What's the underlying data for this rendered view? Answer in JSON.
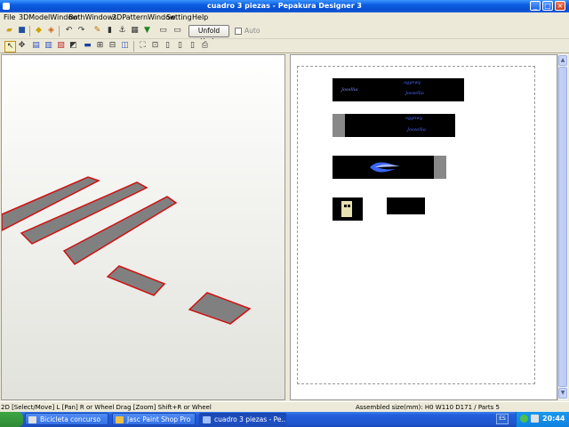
{
  "window": {
    "title": "cuadro 3 piezas - Pepakura Designer 3"
  },
  "menu": [
    "File",
    "3DModelWindow",
    "BothWindows",
    "2DPatternWindow",
    "Setting",
    "Help"
  ],
  "toolbar": {
    "unfold_undo_label": "Unfold Undo",
    "auto_label": "Auto"
  },
  "pattern_view": {
    "labels": {
      "small_text_a": "ogynwy",
      "small_text_b": "Jossellia",
      "small_text_c": "Josellia"
    }
  },
  "status": {
    "left": "2D [Select/Move] L [Pan] R or Wheel Drag [Zoom] Shift+R or Wheel",
    "right": "Assembled size(mm): H0 W110 D171 / Parts 5"
  },
  "taskbar": {
    "tasks": [
      {
        "label": "Bicicleta concurso",
        "active": false
      },
      {
        "label": "Jasc Paint Shop Pro",
        "active": false
      },
      {
        "label": "cuadro 3 piezas - Pe...",
        "active": true
      }
    ],
    "language": "ES",
    "clock": "20:44"
  },
  "colors": {
    "face_fill": "#808080",
    "face_edge": "#d01010",
    "part_fill": "#000000",
    "accent_blue": "#4d6bff"
  },
  "icons": {
    "toolbar1": [
      "open-icon",
      "save-icon",
      "model-icon",
      "cube-icon",
      "undo-icon",
      "redo-icon",
      "pencil-icon",
      "bucket-icon",
      "anchor-icon",
      "grid-icon",
      "download-icon",
      "window-icon",
      "window-icon"
    ],
    "toolbar2": [
      "select-icon",
      "move-icon",
      "pan-icon",
      "zoom-icon",
      "texture-icon",
      "edge-icon",
      "line-icon",
      "join-icon",
      "split-icon",
      "rotate-icon",
      "flip-icon",
      "fit-icon",
      "page-icon",
      "print-icon"
    ]
  }
}
